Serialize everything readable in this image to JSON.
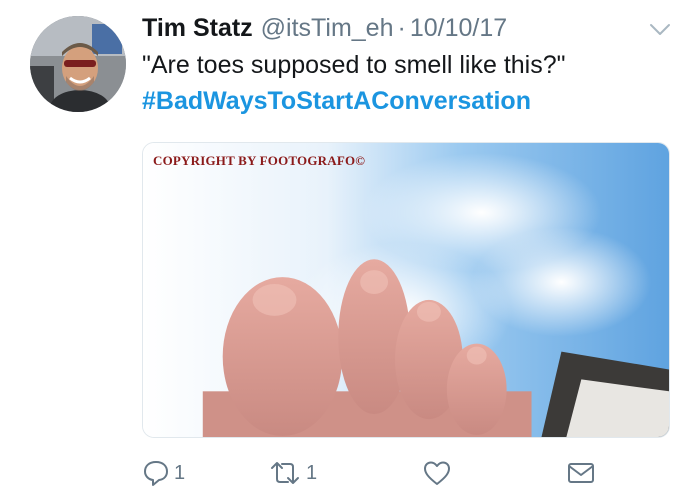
{
  "tweet": {
    "display_name": "Tim Statz",
    "handle": "@itsTim_eh",
    "separator": "·",
    "date": "10/10/17",
    "text": "\"Are toes supposed to smell like this?\"",
    "hashtag": "#BadWaysToStartAConversation"
  },
  "media": {
    "watermark": "COPYRIGHT BY FOOTOGRAFO©",
    "colors": {
      "sky": "#7fb6e6",
      "skin": "#d9998f",
      "roof": "#3c3a38"
    }
  },
  "actions": {
    "reply": {
      "icon": "reply-icon",
      "count": "1"
    },
    "retweet": {
      "icon": "retweet-icon",
      "count": "1"
    },
    "like": {
      "icon": "heart-icon",
      "count": ""
    },
    "message": {
      "icon": "envelope-icon"
    }
  },
  "colors": {
    "text": "#14171a",
    "secondary": "#657786",
    "link": "#1b95e0"
  }
}
